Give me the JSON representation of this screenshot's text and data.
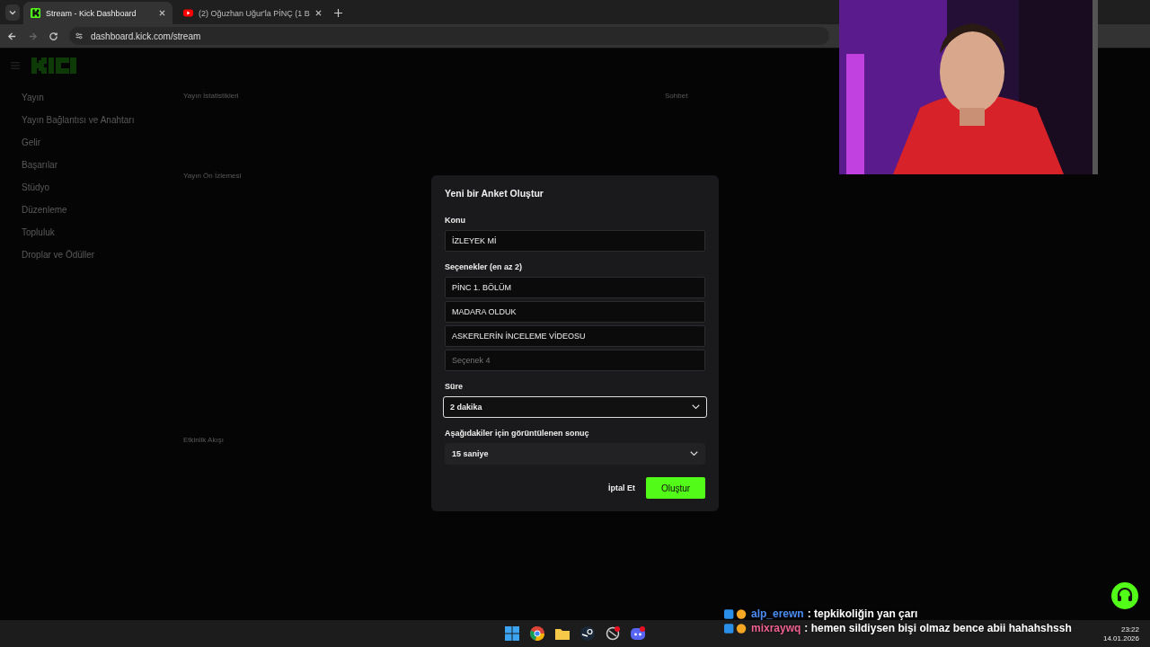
{
  "browser": {
    "tabs": [
      {
        "title": "Stream - Kick Dashboard",
        "kind": "kick",
        "selected": true
      },
      {
        "title": "(2) Oğuzhan Uğur'la PİNÇ (1 B",
        "kind": "video",
        "selected": false
      }
    ],
    "address": "dashboard.kick.com/stream"
  },
  "sidebar": {
    "items": [
      {
        "label": "Yayın"
      },
      {
        "label": "Yayın Bağlantısı ve Anahtarı"
      },
      {
        "label": "Gelir"
      },
      {
        "label": "Başarılar"
      },
      {
        "label": "Stüdyo"
      },
      {
        "label": "Düzenleme"
      },
      {
        "label": "Topluluk"
      },
      {
        "label": "Droplar ve Ödüller"
      }
    ]
  },
  "panels": [
    {
      "title": "Yayın İstatistikleri"
    },
    {
      "title": "Yayın Ön İzlemesi"
    },
    {
      "title": "Etkinlik Akışı"
    },
    {
      "title": "Sohbet"
    }
  ],
  "dialog": {
    "title": "Yeni bir Anket Oluştur",
    "topic": {
      "label": "Konu",
      "value": "İZLEYEK Mİ"
    },
    "options": {
      "label": "Seçenekler (en az 2)",
      "items": [
        {
          "value": "PİNC 1. BÖLÜM"
        },
        {
          "value": "MADARA OLDUK"
        },
        {
          "value": "ASKERLERİN İNCELEME VİDEOSU"
        },
        {
          "placeholder": "Seçenek 4"
        }
      ]
    },
    "duration": {
      "label": "Süre",
      "value": "2 dakika",
      "focused": true
    },
    "result": {
      "label": "Aşağıdakiler için görüntülenen sonuç",
      "value": "15 saniye",
      "focused": false
    },
    "cancel": "İptal Et",
    "submit": "Oluştur"
  },
  "chat_overlay": [
    {
      "user": "alp_erewn",
      "color": "#4c8df5",
      "text": ": tepkikoliğin yan çarı"
    },
    {
      "user": "mixraywq",
      "color": "#f06292",
      "text": ": hemen sildiysen bişi olmaz bence abii hahahshssh"
    }
  ],
  "taskbar": {
    "time": "23:22",
    "date": "14.01.2026"
  }
}
